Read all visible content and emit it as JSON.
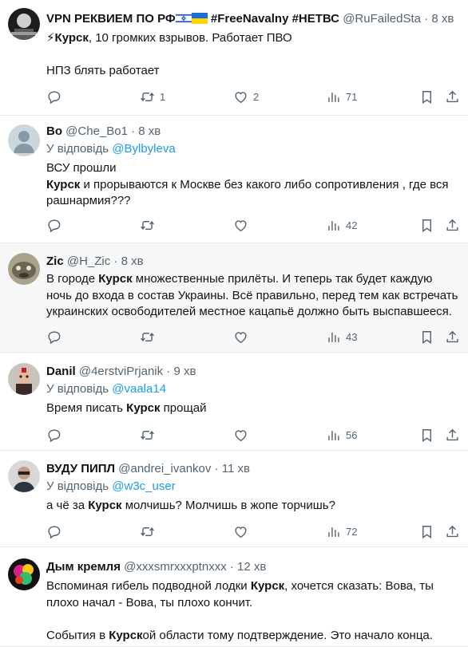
{
  "tweets": [
    {
      "name": "VPN РЕКВИЕМ ПО РФ",
      "name_suffix": " #FreeNavalny #НЕТВС",
      "handle": "@RuFailedSta",
      "time": "8 хв",
      "reply_label": "",
      "reply_to": "",
      "lines": [
        "⚡Курск, 10 громких взрывов. Работает ПВО",
        "",
        "НПЗ блять работает"
      ],
      "counts": {
        "reply": "",
        "retweet": "1",
        "like": "2",
        "views": "71"
      }
    },
    {
      "name": "Bo",
      "name_suffix": "",
      "handle": "@Che_Bo1",
      "time": "8 хв",
      "reply_label": "У відповідь",
      "reply_to": "@Bylbyleva",
      "lines": [
        "ВСУ прошли",
        "Курск и прорываются к Москве без какого либо  сопротивления , где вся",
        "рашнармия???"
      ],
      "counts": {
        "reply": "",
        "retweet": "",
        "like": "",
        "views": "42"
      }
    },
    {
      "name": "Zic",
      "name_suffix": "",
      "handle": "@H_Zic",
      "time": "8 хв",
      "reply_label": "",
      "reply_to": "",
      "lines": [
        "В городе Курск множественные прилёты. И теперь так будет каждую",
        "ночь до входа в состав Украины. Всё правильно, перед тем как встречать",
        "украинских освободителей местное кацапьё должно быть выспавшееся."
      ],
      "counts": {
        "reply": "",
        "retweet": "",
        "like": "",
        "views": "43"
      }
    },
    {
      "name": "Danil",
      "name_suffix": "",
      "handle": "@4erstviPrjanik",
      "time": "9 хв",
      "reply_label": "У відповідь",
      "reply_to": "@vaala14",
      "lines": [
        "Время писать Курск прощай"
      ],
      "counts": {
        "reply": "",
        "retweet": "",
        "like": "",
        "views": "56"
      }
    },
    {
      "name": "ВУДУ ПИПЛ",
      "name_suffix": "",
      "handle": "@andrei_ivankov",
      "time": "11 хв",
      "reply_label": "У відповідь",
      "reply_to": "@w3c_user",
      "lines": [
        "а чё за Курск молчишь? Молчишь в жопе торчишь?"
      ],
      "counts": {
        "reply": "",
        "retweet": "",
        "like": "",
        "views": "72"
      }
    },
    {
      "name": "Дым кремля",
      "name_suffix": "",
      "handle": "@xxxsmrxxxptnxxx",
      "time": "12 хв",
      "reply_label": "",
      "reply_to": "",
      "lines": [
        "Вспоминая гибель подводной лодки Курск, хочется сказать: Вова, ты",
        "плохо начал - Вова, ты плохо кончит.",
        "",
        "События в Курской области тому подтверждение. Это начало конца."
      ],
      "counts": {
        "reply": "",
        "retweet": "",
        "like": "",
        "views": ""
      }
    }
  ],
  "bold_word": "Курск",
  "colors": {
    "link": "#1d9bf0",
    "muted": "#536471",
    "text": "#0f1419",
    "divider": "#e7e9ea"
  },
  "icons": [
    "reply-icon",
    "retweet-icon",
    "like-icon",
    "views-icon",
    "bookmark-icon",
    "share-icon"
  ]
}
